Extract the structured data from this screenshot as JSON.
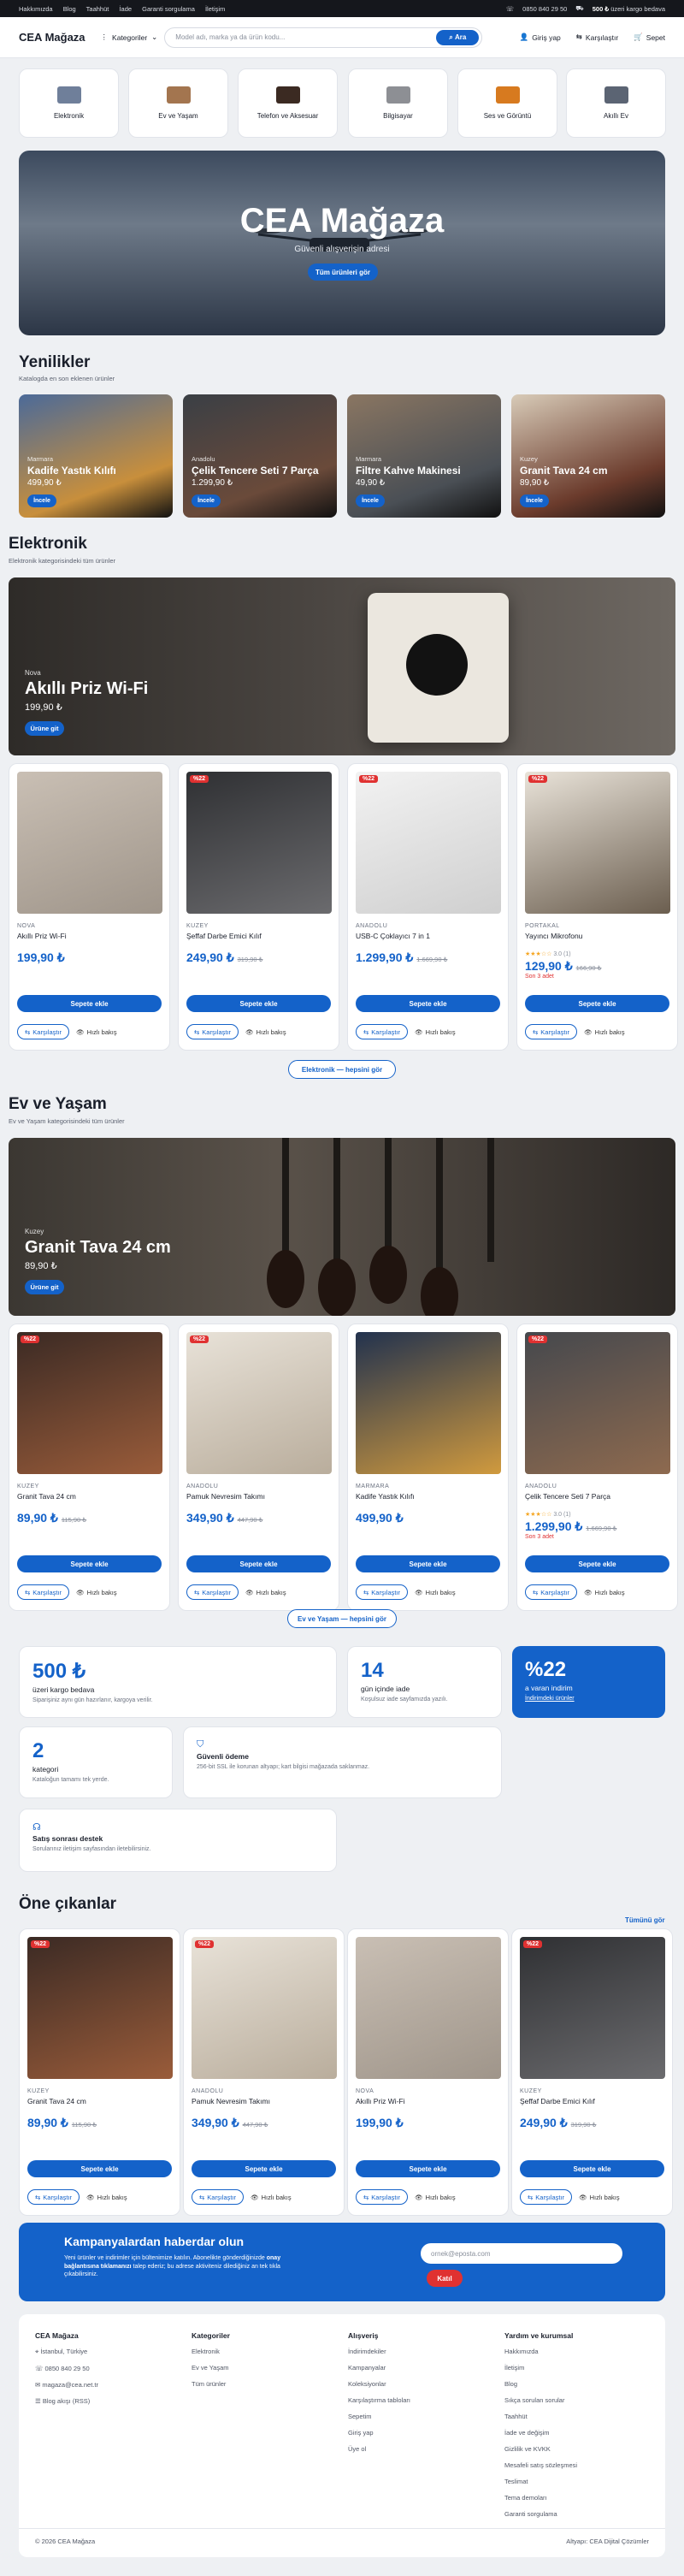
{
  "topbar": {
    "links": [
      "Hakkımızda",
      "Blog",
      "Taahhüt",
      "İade",
      "Garanti sorgulama",
      "İletişim"
    ],
    "phone": "0850 840 29 50",
    "shipping_amount": "500 ₺",
    "shipping_text": "üzeri kargo bedava"
  },
  "header": {
    "logo": "CEA Mağaza",
    "categories_label": "Kategoriler",
    "search_placeholder": "Model adı, marka ya da ürün kodu...",
    "search_button": "Ara",
    "login": "Giriş yap",
    "compare": "Karşılaştır",
    "cart": "Sepet"
  },
  "categories": [
    {
      "name": "Elektronik",
      "color": "#6f7f9a"
    },
    {
      "name": "Ev ve Yaşam",
      "color": "#a3754f"
    },
    {
      "name": "Telefon ve Aksesuar",
      "color": "#3b2a22"
    },
    {
      "name": "Bilgisayar",
      "color": "#8d8f94"
    },
    {
      "name": "Ses ve Görüntü",
      "color": "#d77a1f"
    },
    {
      "name": "Akıllı Ev",
      "color": "#5b6473"
    }
  ],
  "hero": {
    "title": "CEA Mağaza",
    "subtitle": "Güvenli alışverişin adresi",
    "button": "Tüm ürünleri gör"
  },
  "new": {
    "title": "Yenilikler",
    "subtitle": "Katalogda en son eklenen ürünler",
    "items": [
      {
        "brand": "Marmara",
        "name": "Kadife Yastık Kılıfı",
        "price": "499,90 ₺",
        "button": "İncele",
        "c1": "#4b6a99",
        "c2": "#c88f3c"
      },
      {
        "brand": "Anadolu",
        "name": "Çelik Tencere Seti 7 Parça",
        "price": "1.299,90 ₺",
        "button": "İncele",
        "c1": "#3a3f45",
        "c2": "#6a4a3a"
      },
      {
        "brand": "Marmara",
        "name": "Filtre Kahve Makinesi",
        "price": "49,90 ₺",
        "button": "İncele",
        "c1": "#8a7662",
        "c2": "#4a4f55"
      },
      {
        "brand": "Kuzey",
        "name": "Granit Tava 24 cm",
        "price": "89,90 ₺",
        "button": "İncele",
        "c1": "#d8cbb8",
        "c2": "#6b3b2c"
      }
    ]
  },
  "elektronik": {
    "title": "Elektronik",
    "subtitle": "Elektronik kategorisindeki tüm ürünler",
    "banner": {
      "brand": "Nova",
      "name": "Akıllı Priz Wi-Fi",
      "price": "199,90 ₺",
      "button": "Ürüne git"
    },
    "see_all": "Elektronik — hepsini gör",
    "products": [
      {
        "discount": "",
        "brand": "NOVA",
        "name": "Akıllı Priz Wi-Fi",
        "price": "199,90 ₺",
        "old": "",
        "rating": "",
        "stock": "",
        "c1": "#c9bfb4",
        "c2": "#9f958a"
      },
      {
        "discount": "%22",
        "brand": "KUZEY",
        "name": "Şeffaf Darbe Emici Kılıf",
        "price": "249,90 ₺",
        "old": "319,90 ₺",
        "rating": "",
        "stock": "",
        "c1": "#2f3033",
        "c2": "#6b6b6e"
      },
      {
        "discount": "%22",
        "brand": "ANADOLU",
        "name": "USB-C Çoklayıcı 7 in 1",
        "price": "1.299,90 ₺",
        "old": "1.669,90 ₺",
        "rating": "",
        "stock": "",
        "c1": "#f2f2f2",
        "c2": "#cfcfcf"
      },
      {
        "discount": "%22",
        "brand": "PORTAKAL",
        "name": "Yayıncı Mikrofonu",
        "price": "129,90 ₺",
        "old": "166,90 ₺",
        "rating": "3.0",
        "reviews": "(1)",
        "stock": "Son 3 adet",
        "c1": "#e9e3d9",
        "c2": "#6b5e4f"
      }
    ]
  },
  "evyasam": {
    "title": "Ev ve Yaşam",
    "subtitle": "Ev ve Yaşam kategorisindeki tüm ürünler",
    "banner": {
      "brand": "Kuzey",
      "name": "Granit Tava 24 cm",
      "price": "89,90 ₺",
      "button": "Ürüne git"
    },
    "see_all": "Ev ve Yaşam — hepsini gör",
    "products": [
      {
        "discount": "%22",
        "brand": "KUZEY",
        "name": "Granit Tava 24 cm",
        "price": "89,90 ₺",
        "old": "115,90 ₺",
        "rating": "",
        "stock": "",
        "c1": "#3b2a24",
        "c2": "#9a5c3a"
      },
      {
        "discount": "%22",
        "brand": "ANADOLU",
        "name": "Pamuk Nevresim Takımı",
        "price": "349,90 ₺",
        "old": "447,90 ₺",
        "rating": "",
        "stock": "",
        "c1": "#e8e2d8",
        "c2": "#b9ad9c"
      },
      {
        "discount": "",
        "brand": "MARMARA",
        "name": "Kadife Yastık Kılıfı",
        "price": "499,90 ₺",
        "old": "",
        "rating": "",
        "stock": "",
        "c1": "#22324e",
        "c2": "#d09a3e"
      },
      {
        "discount": "%22",
        "brand": "ANADOLU",
        "name": "Çelik Tencere Seti 7 Parça",
        "price": "1.299,90 ₺",
        "old": "1.669,90 ₺",
        "rating": "3.0",
        "reviews": "(1)",
        "stock": "Son 3 adet",
        "c1": "#45484d",
        "c2": "#8e6a4f"
      }
    ]
  },
  "stats": {
    "shipping": {
      "value": "500 ₺",
      "label": "üzeri kargo bedava",
      "desc": "Siparişiniz aynı gün hazırlanır, kargoya verilir."
    },
    "returns": {
      "value": "14",
      "label": "gün içinde iade",
      "desc": "Koşulsuz iade sayfamızda yazılı."
    },
    "discount": {
      "value": "%22",
      "label": "a varan indirim",
      "link": "İndirimdeki ürünler"
    },
    "categories": {
      "value": "2",
      "label": "kategori",
      "desc": "Kataloğun tamamı tek yerde."
    },
    "payment": {
      "label": "Güvenli ödeme",
      "desc": "256-bit SSL ile korunan altyapı; kart bilgisi mağazada saklanmaz."
    },
    "support": {
      "label": "Satış sonrası destek",
      "desc": "Sorularınız iletişim sayfasından iletebilirsiniz."
    }
  },
  "featured": {
    "title": "Öne çıkanlar",
    "see_all": "Tümünü gör",
    "products": [
      {
        "discount": "%22",
        "brand": "KUZEY",
        "name": "Granit Tava 24 cm",
        "price": "89,90 ₺",
        "old": "115,90 ₺",
        "rating": "",
        "stock": "",
        "c1": "#3b2a24",
        "c2": "#9a5c3a"
      },
      {
        "discount": "%22",
        "brand": "ANADOLU",
        "name": "Pamuk Nevresim Takımı",
        "price": "349,90 ₺",
        "old": "447,90 ₺",
        "rating": "",
        "stock": "",
        "c1": "#e8e2d8",
        "c2": "#b9ad9c"
      },
      {
        "discount": "",
        "brand": "NOVA",
        "name": "Akıllı Priz Wi-Fi",
        "price": "199,90 ₺",
        "old": "",
        "rating": "",
        "stock": "",
        "c1": "#c9bfb4",
        "c2": "#9f958a"
      },
      {
        "discount": "%22",
        "brand": "KUZEY",
        "name": "Şeffaf Darbe Emici Kılıf",
        "price": "249,90 ₺",
        "old": "319,90 ₺",
        "rating": "",
        "stock": "",
        "c1": "#2f3033",
        "c2": "#6b6b6e"
      }
    ]
  },
  "product_labels": {
    "add": "Sepete ekle",
    "compare": "Karşılaştır",
    "quick": "Hızlı bakış"
  },
  "newsletter": {
    "title": "Kampanyalardan haberdar olun",
    "text1": "Yeni ürünler ve indirimler için bültenimize katılın. Abonelikte",
    "text2": "gönderdiğinizde",
    "bold": "onay bağlantısına tıklamanızı",
    "text3": "talep ederiz; bu adrese aktiviteniz",
    "text4": "dilediğiniz an tek tıkla çıkabilirsiniz.",
    "placeholder": "ornek@eposta.com",
    "button": "Katıl"
  },
  "footer": {
    "store": {
      "title": "CEA Mağaza",
      "items": [
        "İstanbul, Türkiye",
        "0850 840 29 50",
        "magaza@cea.net.tr",
        "Blog akışı (RSS)"
      ]
    },
    "categories": {
      "title": "Kategoriler",
      "items": [
        "Elektronik",
        "Ev ve Yaşam",
        "Tüm ürünler"
      ]
    },
    "shopping": {
      "title": "Alışveriş",
      "items": [
        "İndirimdekiler",
        "Kampanyalar",
        "Koleksiyonlar",
        "Karşılaştırma tabloları",
        "Sepetim",
        "Giriş yap",
        "Üye ol"
      ]
    },
    "help": {
      "title": "Yardım ve kurumsal",
      "items": [
        "Hakkımızda",
        "İletişim",
        "Blog",
        "Sıkça sorulan sorular",
        "Taahhüt",
        "İade ve değişim",
        "Gizlilik ve KVKK",
        "Mesafeli satış sözleşmesi",
        "Teslimat",
        "Tema demoları",
        "Garanti sorgulama"
      ]
    },
    "copyright": "© 2026 CEA Mağaza",
    "credit": "Altyapı: CEA Dijital Çözümler"
  }
}
